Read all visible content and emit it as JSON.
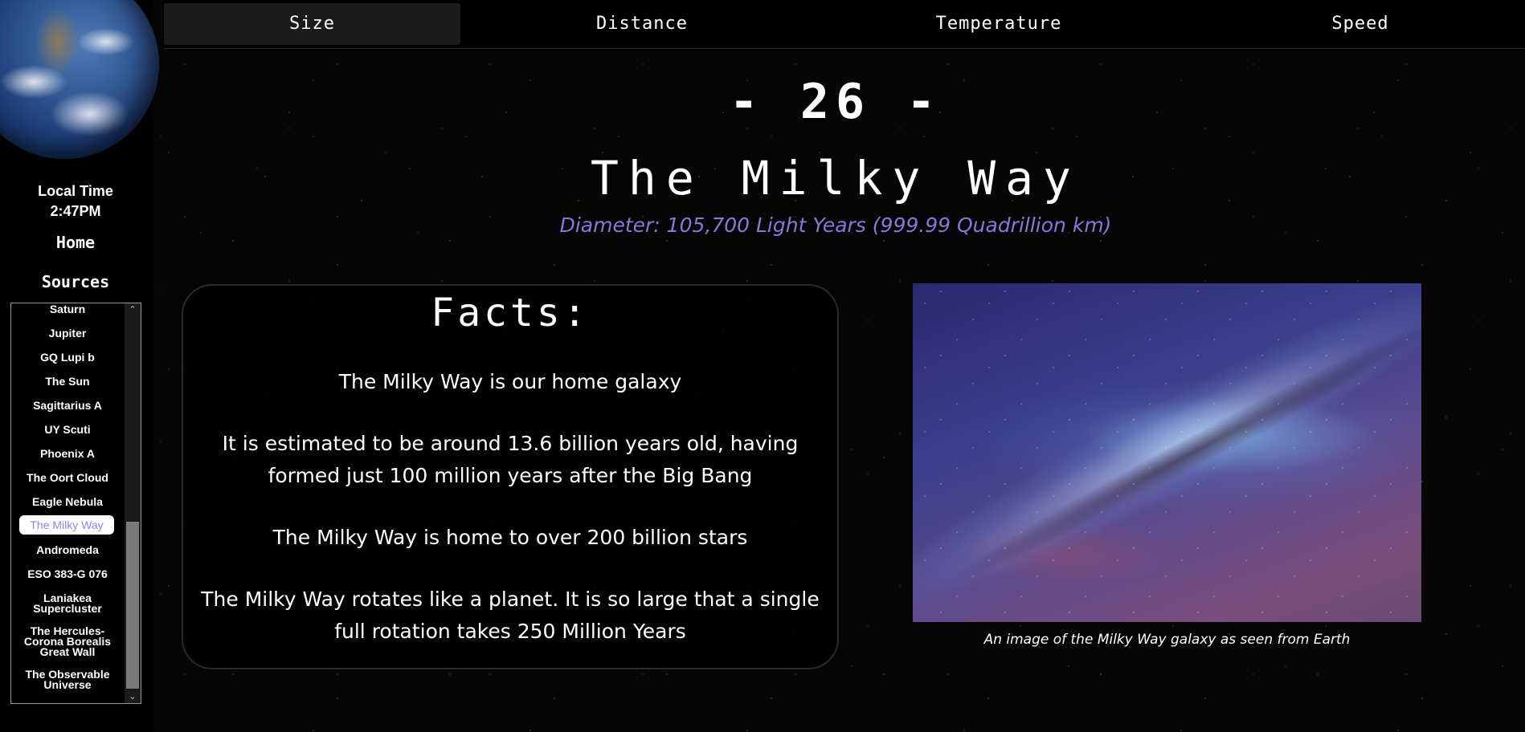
{
  "sidebar": {
    "local_time_label": "Local Time",
    "local_time_value": "2:47PM",
    "home_label": "Home",
    "sources_label": "Sources",
    "list": [
      "Saturn",
      "Jupiter",
      "GQ Lupi b",
      "The Sun",
      "Sagittarius A",
      "UY Scuti",
      "Phoenix A",
      "The Oort Cloud",
      "Eagle Nebula",
      "The Milky Way",
      "Andromeda",
      "ESO 383-G 076",
      "Laniakea Supercluster",
      "The Hercules-Corona Borealis Great Wall",
      "The Observable Universe"
    ],
    "active_item": "The Milky Way"
  },
  "tabs": [
    "Size",
    "Distance",
    "Temperature",
    "Speed"
  ],
  "active_tab": "Size",
  "main": {
    "rank": "- 26 -",
    "title": "The Milky Way",
    "diameter": "Diameter: 105,700 Light Years (999.99 Quadrillion km)",
    "facts_title": "Facts:",
    "facts": [
      "The Milky Way is our home galaxy",
      "It is estimated to be around 13.6 billion years old, having formed just 100 million years after the Big Bang",
      "The Milky Way is home to over 200 billion stars",
      "The Milky Way rotates like a planet. It is so large that a single full rotation takes 250 Million Years"
    ],
    "image_caption": "An image of the Milky Way galaxy as seen from Earth"
  },
  "icons": {
    "scroll_up": "chevron-up-icon",
    "scroll_down": "chevron-down-icon"
  },
  "colors": {
    "accent": "#8b76d9",
    "background": "#050505"
  }
}
